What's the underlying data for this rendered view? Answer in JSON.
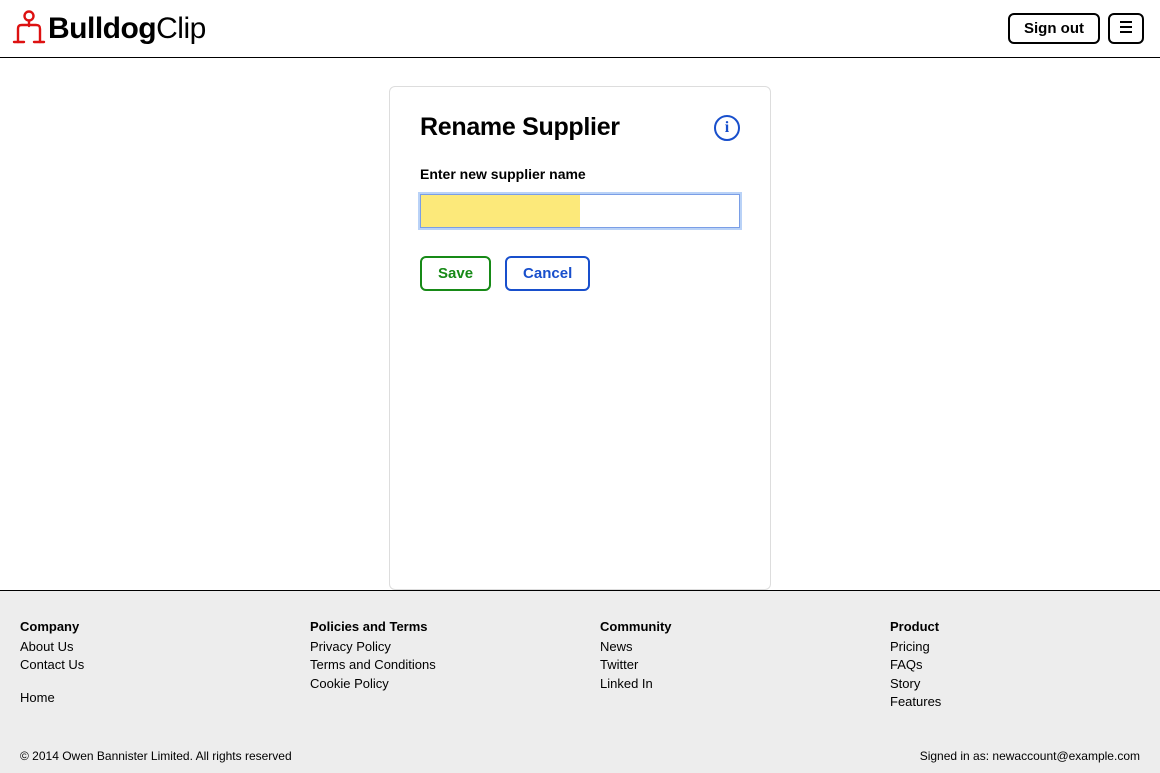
{
  "header": {
    "brand_bold": "Bulldog",
    "brand_thin": "Clip",
    "sign_out": "Sign out"
  },
  "card": {
    "title": "Rename Supplier",
    "field_label": "Enter new supplier name",
    "input_value": "",
    "save": "Save",
    "cancel": "Cancel",
    "info": "i"
  },
  "footer": {
    "col1": {
      "heading": "Company",
      "links": [
        "About Us",
        "Contact Us"
      ],
      "home": "Home"
    },
    "col2": {
      "heading": "Policies and Terms",
      "links": [
        "Privacy Policy",
        "Terms and Conditions",
        "Cookie Policy"
      ]
    },
    "col3": {
      "heading": "Community",
      "links": [
        "News",
        "Twitter",
        "Linked In"
      ]
    },
    "col4": {
      "heading": "Product",
      "links": [
        "Pricing",
        "FAQs",
        "Story",
        "Features"
      ]
    },
    "copyright": "© 2014 Owen Bannister Limited. All rights reserved",
    "signed_in": "Signed in as: newaccount@example.com"
  }
}
